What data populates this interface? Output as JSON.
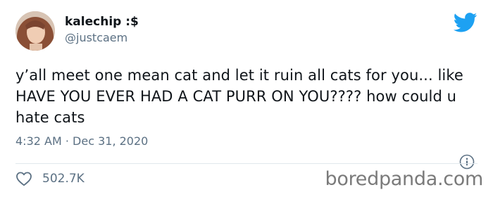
{
  "tweet": {
    "author": {
      "display_name": "kalechip :$",
      "handle": "@justcaem"
    },
    "text": "y’all meet one mean cat and let it ruin all cats for you... like HAVE YOU EVER HAD A CAT PURR ON YOU???? how could u hate cats",
    "time": "4:32 AM",
    "separator": "·",
    "date": "Dec 31, 2020",
    "likes": "502.7K"
  },
  "icons": {
    "platform": "twitter-bird-icon",
    "info": "info-icon",
    "like": "heart-icon"
  },
  "colors": {
    "brand_blue": "#1da1f2",
    "text": "#0f1419",
    "secondary_text": "#5b7083",
    "divider": "#e1e8ed",
    "watermark": "#7a7a7a"
  },
  "watermark": "boredpanda.com"
}
